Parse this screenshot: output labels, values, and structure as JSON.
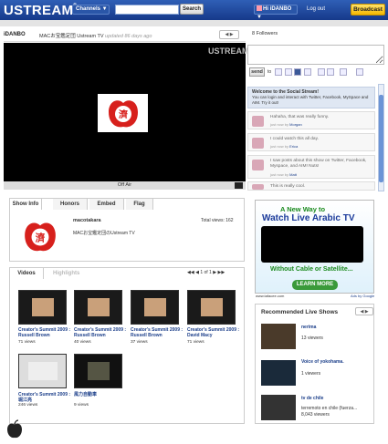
{
  "topbar": {
    "logo": "USTREAM",
    "logo_mark": "®",
    "channels": "Channels ▼",
    "search_placeholder": "",
    "search_btn": "Search",
    "user": "Hi iDANBO ▼",
    "logout": "Log out",
    "broadcast": "Broadcast"
  },
  "stream": {
    "owner": "iDANBO",
    "title": "MACお宝鑑定団 Ustream TV",
    "updated": "updated 86 days ago",
    "watermark": "USTREAM",
    "offair": "Off Air",
    "stamp_text": "濟"
  },
  "social": {
    "followers": "8 Followers",
    "send": "send",
    "to": "to",
    "welcome_title": "Welcome to the Social Stream!",
    "welcome_text": "You can login and interact with Twitter, Facebook, MySpace and AIM. Try it out!",
    "feed": [
      {
        "text": "Hahaha, that was really funny.",
        "meta": "just now by",
        "who": "Morgan"
      },
      {
        "text": "I could watch this all day.",
        "meta": "just now by",
        "who": "Erica"
      },
      {
        "text": "I saw posts about this show on Twitter, Facebook, Myspace, and AIM! Nuts!",
        "meta": "just now by",
        "who": "Matt"
      },
      {
        "text": "This is really cool.",
        "meta": "",
        "who": ""
      }
    ]
  },
  "tabs": [
    "Show Info",
    "Honors",
    "Embed",
    "Flag"
  ],
  "info": {
    "user": "macotakara",
    "total": "Total views: 162",
    "desc": "MACお宝鑑定団のUstream TV"
  },
  "videos": {
    "tab_videos": "Videos",
    "tab_highlights": "Highlights",
    "page": "1",
    "of": "of 1",
    "items": [
      {
        "title": "Creator's Summit 2009 : Russell Brown",
        "views": "71 views"
      },
      {
        "title": "Creator's Summit 2009 : Russell Brown",
        "views": "40 views"
      },
      {
        "title": "Creator's Summit 2009 : Russell Brown",
        "views": "37 views"
      },
      {
        "title": "Creator's Summit 2009 : David Macy",
        "views": "71 views"
      },
      {
        "title": "Creator's Summit 2009 : 堀江亮",
        "views": "246 views"
      },
      {
        "title": "風力自動車",
        "views": "9 views"
      }
    ]
  },
  "ad": {
    "line1": "A New Way to",
    "line2": "Watch Live Arabic TV",
    "line3": "Without Cable or Satellite...",
    "button": "LEARN MORE",
    "url": "www.tafacee.com",
    "by": "Ads by Google"
  },
  "recommended": {
    "title": "Recommended Live Shows",
    "items": [
      {
        "title": "nerima",
        "sub": "13 viewers"
      },
      {
        "title": "Voice of yokohama.",
        "sub": "1 viewers"
      },
      {
        "title": "tv de chile",
        "sub": "terremoto en chile (fuerza...",
        "sub2": "8,043 viewers"
      }
    ]
  },
  "colors": {
    "topbar": "#1f4aa0",
    "link": "#1c3f8a",
    "ad_green": "#1a8a1e",
    "broadcast": "#f5b800"
  }
}
